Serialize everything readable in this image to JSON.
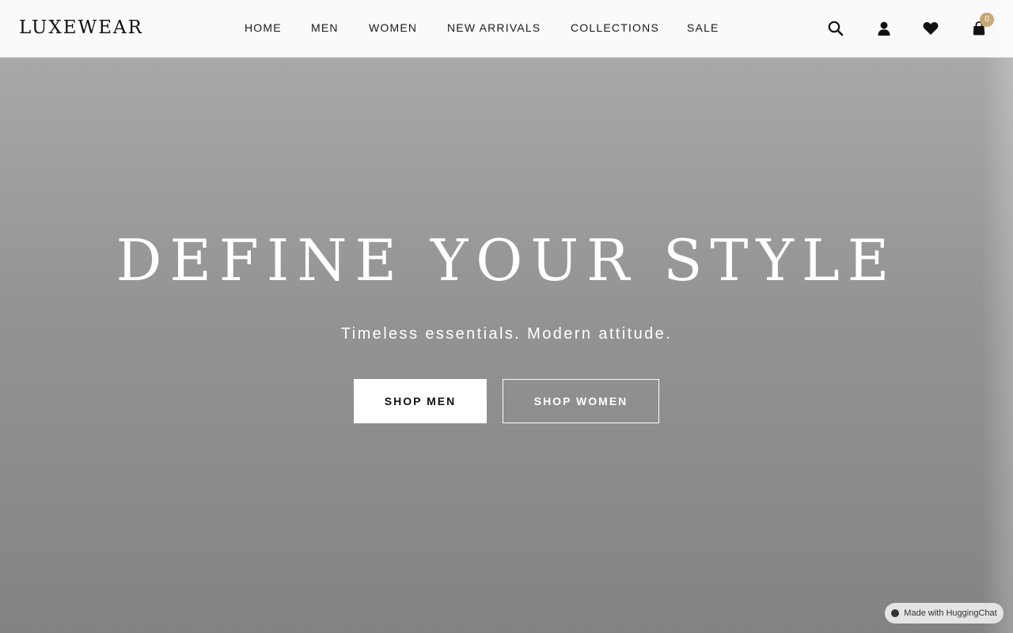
{
  "header": {
    "logo": "LUXEWEAR",
    "nav": [
      "HOME",
      "MEN",
      "WOMEN",
      "NEW ARRIVALS",
      "COLLECTIONS",
      "SALE"
    ],
    "icons": {
      "search": "search-icon",
      "account": "user-icon",
      "wishlist": "heart-icon",
      "cart": "shopping-bag-icon"
    },
    "cart_count": "0"
  },
  "hero": {
    "title": "DEFINE YOUR STYLE",
    "subtitle": "Timeless essentials. Modern attitude.",
    "primary_cta": "SHOP MEN",
    "secondary_cta": "SHOP WOMEN"
  },
  "footer_badge": {
    "label": "Made with HuggingChat"
  },
  "colors": {
    "accent": "#c6a46b",
    "header_bg": "#fafafa"
  }
}
